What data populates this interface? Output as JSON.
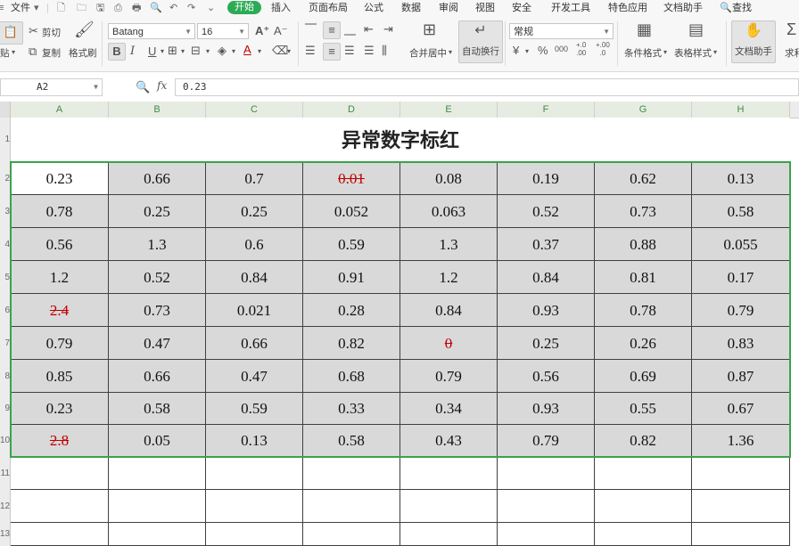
{
  "menubar": {
    "file": "文件",
    "tabs": [
      "开始",
      "插入",
      "页面布局",
      "公式",
      "数据",
      "审阅",
      "视图",
      "安全",
      "开发工具",
      "特色应用",
      "文档助手"
    ],
    "search": "查找"
  },
  "ribbon": {
    "paste": "贴",
    "cut": "剪切",
    "copy": "复制",
    "format_painter": "格式刷",
    "font_name": "Batang",
    "font_size": "16",
    "bold": "B",
    "italic": "I",
    "underline": "U",
    "merge_center": "合并居中",
    "wrap_text": "自动换行",
    "number_format": "常规",
    "percent": "%",
    "thousands": "000",
    "inc_decimal": "+.0\n.00",
    "dec_decimal": "+.00\n.0",
    "cond_format": "条件格式",
    "table_style": "表格样式",
    "doc_helper": "文档助手",
    "sum": "求和"
  },
  "formula_bar": {
    "cell_ref": "A2",
    "fx": "fx",
    "content": "0.23"
  },
  "columns": [
    "A",
    "B",
    "C",
    "D",
    "E",
    "F",
    "G",
    "H"
  ],
  "rows": [
    "1",
    "2",
    "3",
    "4",
    "5",
    "6",
    "7",
    "8",
    "9",
    "10",
    "11",
    "12",
    "13"
  ],
  "sheet": {
    "title": "异常数字标红",
    "table": [
      [
        "0.23",
        "0.66",
        "0.7",
        "0.01",
        "0.08",
        "0.19",
        "0.62",
        "0.13"
      ],
      [
        "0.78",
        "0.25",
        "0.25",
        "0.052",
        "0.063",
        "0.52",
        "0.73",
        "0.58"
      ],
      [
        "0.56",
        "1.3",
        "0.6",
        "0.59",
        "1.3",
        "0.37",
        "0.88",
        "0.055"
      ],
      [
        "1.2",
        "0.52",
        "0.84",
        "0.91",
        "1.2",
        "0.84",
        "0.81",
        "0.17"
      ],
      [
        "2.4",
        "0.73",
        "0.021",
        "0.28",
        "0.84",
        "0.93",
        "0.78",
        "0.79"
      ],
      [
        "0.79",
        "0.47",
        "0.66",
        "0.82",
        "0",
        "0.25",
        "0.26",
        "0.83"
      ],
      [
        "0.85",
        "0.66",
        "0.47",
        "0.68",
        "0.79",
        "0.56",
        "0.69",
        "0.87"
      ],
      [
        "0.23",
        "0.58",
        "0.59",
        "0.33",
        "0.34",
        "0.93",
        "0.55",
        "0.67"
      ],
      [
        "2.8",
        "0.05",
        "0.13",
        "0.58",
        "0.43",
        "0.79",
        "0.82",
        "1.36"
      ]
    ],
    "flagged_cells": [
      [
        0,
        3
      ],
      [
        4,
        0
      ],
      [
        5,
        4
      ],
      [
        8,
        0
      ]
    ],
    "flag_color": "#c00000",
    "fill_color": "#d9d9d9",
    "selection_color": "#3aa34b"
  }
}
